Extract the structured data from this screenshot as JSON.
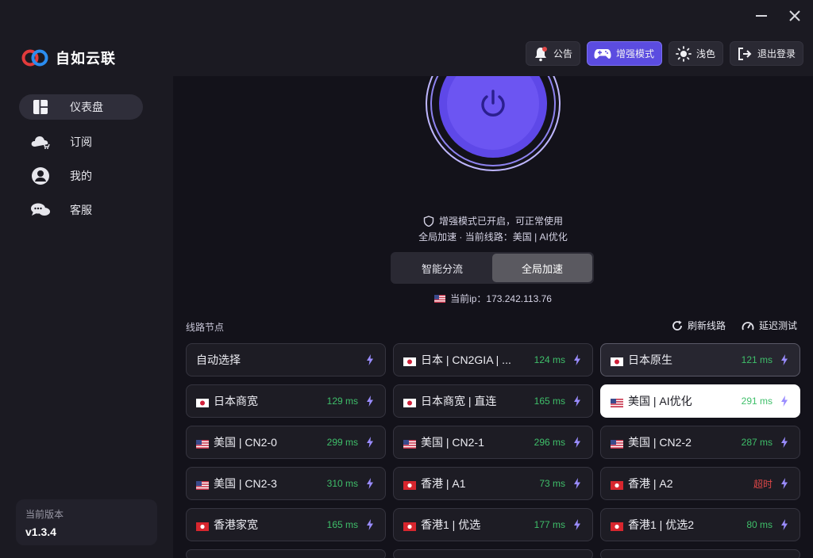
{
  "app": {
    "name": "自如云联"
  },
  "window": {
    "minimize": "—",
    "close": "✕"
  },
  "toolbar": {
    "announcement": "公告",
    "enhanced_mode": "增强模式",
    "theme": "浅色",
    "logout": "退出登录"
  },
  "sidebar": {
    "items": [
      {
        "label": "仪表盘",
        "icon": "dashboard-icon",
        "active": true
      },
      {
        "label": "订阅",
        "icon": "cloud-cart-icon",
        "active": false
      },
      {
        "label": "我的",
        "icon": "user-icon",
        "active": false
      },
      {
        "label": "客服",
        "icon": "chat-icon",
        "active": false
      }
    ],
    "version_title": "当前版本",
    "version_value": "v1.3.4"
  },
  "status": {
    "message": "增强模式已开启，可正常使用",
    "route": "全局加速 · 当前线路：美国 | AI优化",
    "ip": "当前ip：173.242.113.76"
  },
  "mode": {
    "options": [
      "智能分流",
      "全局加速"
    ],
    "selected": "全局加速"
  },
  "nodes_section": {
    "title": "线路节点",
    "refresh": "刷新线路",
    "latency_test": "延迟测试"
  },
  "nodes": [
    {
      "name": "自动选择",
      "flag": "",
      "latency": ""
    },
    {
      "name": "日本 | CN2GIA | ...",
      "flag": "jp",
      "latency": "124 ms"
    },
    {
      "name": "日本原生",
      "flag": "jp",
      "latency": "121 ms",
      "state": "hover"
    },
    {
      "name": "日本商宽",
      "flag": "jp",
      "latency": "129 ms"
    },
    {
      "name": "日本商宽 | 直连",
      "flag": "jp",
      "latency": "165 ms"
    },
    {
      "name": "美国 | AI优化",
      "flag": "us",
      "latency": "291 ms",
      "state": "selected"
    },
    {
      "name": "美国 | CN2-0",
      "flag": "us",
      "latency": "299 ms"
    },
    {
      "name": "美国 | CN2-1",
      "flag": "us",
      "latency": "296 ms"
    },
    {
      "name": "美国 | CN2-2",
      "flag": "us",
      "latency": "287 ms"
    },
    {
      "name": "美国 | CN2-3",
      "flag": "us",
      "latency": "310 ms"
    },
    {
      "name": "香港 | A1",
      "flag": "hk",
      "latency": "73 ms"
    },
    {
      "name": "香港 | A2",
      "flag": "hk",
      "latency": "超时",
      "timeout": true
    },
    {
      "name": "香港家宽",
      "flag": "hk",
      "latency": "165 ms"
    },
    {
      "name": "香港1 | 优选",
      "flag": "hk",
      "latency": "177 ms"
    },
    {
      "name": "香港1 | 优选2",
      "flag": "hk",
      "latency": "80 ms"
    }
  ],
  "colors": {
    "accent": "#5b4ce0",
    "power": "#6c55f2",
    "latency_ok": "#3fbf6a",
    "latency_timeout": "#e04848"
  }
}
